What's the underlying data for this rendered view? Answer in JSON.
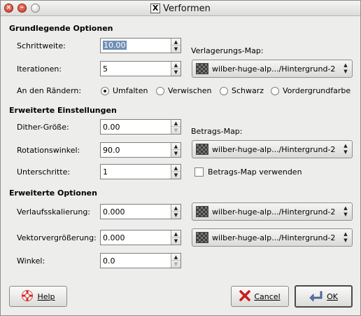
{
  "window": {
    "title": "Verformen",
    "x_logo": "X"
  },
  "sections": {
    "basic": "Grundlegende Optionen",
    "advanced_settings": "Erweiterte Einstellungen",
    "advanced_options": "Erweiterte Optionen"
  },
  "fields": {
    "schrittweite": {
      "label": "Schrittweite:",
      "value": "10.00"
    },
    "iterationen": {
      "label": "Iterationen:",
      "value": "5"
    },
    "dither": {
      "label": "Dither-Größe:",
      "value": "0.00"
    },
    "rotation": {
      "label": "Rotationswinkel:",
      "value": "90.0"
    },
    "unterschritte": {
      "label": "Unterschritte:",
      "value": "1"
    },
    "verlaufsskalierung": {
      "label": "Verlaufsskalierung:",
      "value": "0.000"
    },
    "vektorvergroesserung": {
      "label": "Vektorvergrößerung:",
      "value": "0.000"
    },
    "winkel": {
      "label": "Winkel:",
      "value": "0.0"
    }
  },
  "edges": {
    "label": "An den Rändern:",
    "options": [
      "Umfalten",
      "Verwischen",
      "Schwarz",
      "Vordergrundfarbe"
    ],
    "selected": "Umfalten"
  },
  "maps": {
    "verlagerung_label": "Verlagerungs-Map:",
    "betrag_label": "Betrags-Map:",
    "image_name": "wilber-huge-alp.../Hintergrund-2",
    "betrag_checkbox": "Betrags-Map verwenden",
    "betrag_checked": false
  },
  "buttons": {
    "help": "Help",
    "cancel": "Cancel",
    "ok": "OK"
  },
  "icons": {
    "close": "close-icon",
    "minimize": "minimize-icon",
    "maximize": "maximize-icon",
    "help": "lifebuoy-icon",
    "cancel": "red-x-icon",
    "ok": "enter-arrow-icon",
    "map_thumb": "image-thumbnail-icon"
  }
}
